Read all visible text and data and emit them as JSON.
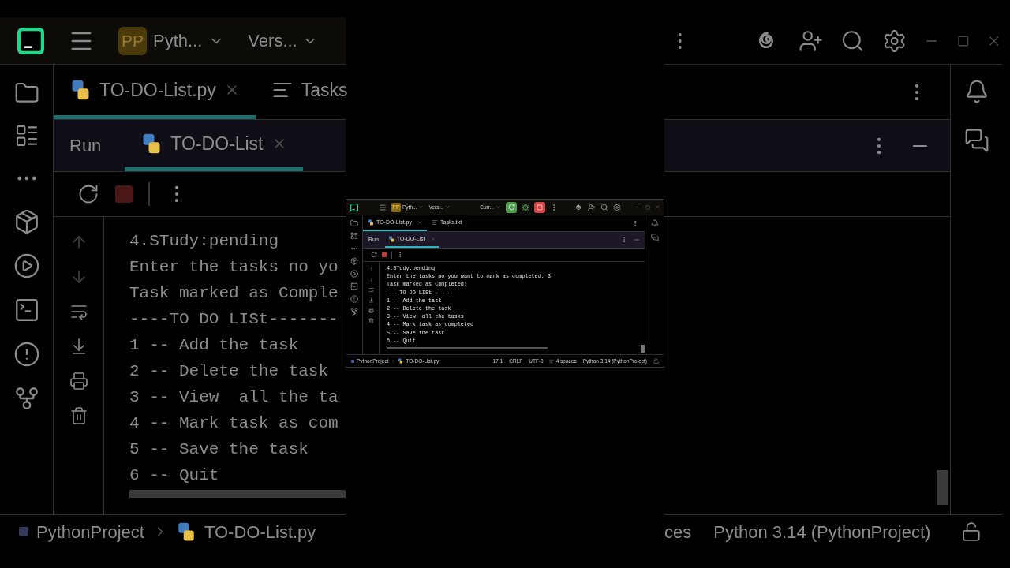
{
  "backdrop_left": {
    "project_initials": "PP",
    "project": "Pyth...",
    "vcs": "Vers...",
    "editor_tabs": [
      {
        "label": "TO-DO-List.py",
        "kind": "python",
        "selected": true
      },
      {
        "label": "Tasks",
        "kind": "text",
        "selected": false
      }
    ],
    "run_title": "Run",
    "run_tabs": [
      {
        "label": "TO-DO-List",
        "selected": true
      }
    ],
    "console_lines": [
      "4.STudy:pending",
      "Enter the tasks no yo",
      "Task marked as Comple",
      "----TO DO LISt-------",
      "1 -- Add the task",
      "2 -- Delete the task",
      "3 -- View  all the ta",
      "4 -- Mark task as com",
      "5 -- Save the task",
      "6 -- Quit"
    ],
    "breadcrumbs": [
      "PythonProject",
      "TO-DO-List.py"
    ]
  },
  "window": {
    "title_bar": {
      "project_initials": "PP",
      "project": "Pyth...",
      "vcs": "Vers...",
      "run_config": "Curr..."
    },
    "editor_tabs": [
      {
        "label": "TO-DO-List.py",
        "kind": "python",
        "selected": true
      },
      {
        "label": "Tasks.txt",
        "kind": "text",
        "selected": false
      }
    ],
    "run_title": "Run",
    "run_tabs": [
      {
        "label": "TO-DO-List",
        "selected": true
      }
    ],
    "console_lines": [
      "4.STudy:pending",
      "Enter the tasks no you want to mark as completed: 3",
      "Task marked as Completed!",
      "----TO DO LISt-------",
      "1 -- Add the task",
      "2 -- Delete the task",
      "3 -- View  all the tasks",
      "4 -- Mark task as completed",
      "5 -- Save the task",
      "6 -- Quit"
    ],
    "status_bar": {
      "breadcrumbs": [
        "PythonProject",
        "TO-DO-List.py"
      ],
      "position": "17:1",
      "line_ending": "CRLF",
      "encoding": "UTF-8",
      "indent": "4 spaces",
      "interpreter": "Python 3.14 (PythonProject)"
    }
  },
  "backdrop_right": {
    "status_tail": "ces",
    "interpreter": "Python 3.14 (PythonProject)"
  }
}
